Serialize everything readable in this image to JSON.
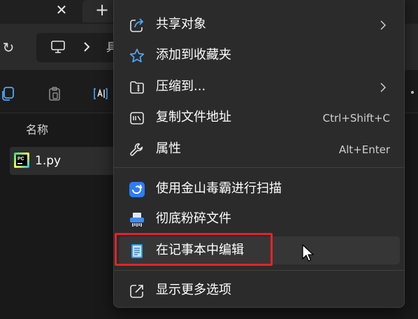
{
  "explorer": {
    "tab_close_glyph": "✕",
    "tab_new_glyph": "+",
    "refresh_glyph": "↻",
    "path_text": "具",
    "column_header": "名称",
    "file": {
      "name": "1.py",
      "icon": "pycharm-icon"
    }
  },
  "menu": {
    "items": [
      {
        "label": "共享对象",
        "icon": "share-icon",
        "submenu": true
      },
      {
        "label": "添加到收藏夹",
        "icon": "star-icon"
      },
      {
        "label": "压缩到...",
        "icon": "zip-folder-icon",
        "submenu": true
      },
      {
        "label": "复制文件地址",
        "icon": "copy-path-icon",
        "shortcut": "Ctrl+Shift+C"
      },
      {
        "label": "属性",
        "icon": "wrench-icon",
        "shortcut": "Alt+Enter"
      },
      {
        "label": "使用金山毒霸进行扫描",
        "icon": "antivirus-icon"
      },
      {
        "label": "彻底粉碎文件",
        "icon": "shredder-icon"
      },
      {
        "label": "在记事本中编辑",
        "icon": "notepad-icon",
        "hovered": true,
        "highlighted": true
      },
      {
        "label": "显示更多选项",
        "icon": "show-more-icon"
      }
    ]
  },
  "colors": {
    "menu_bg": "#2b2b2b",
    "hover_bg": "#363636",
    "accent_blue": "#4aa8ff",
    "highlight_red": "#e0242a"
  }
}
